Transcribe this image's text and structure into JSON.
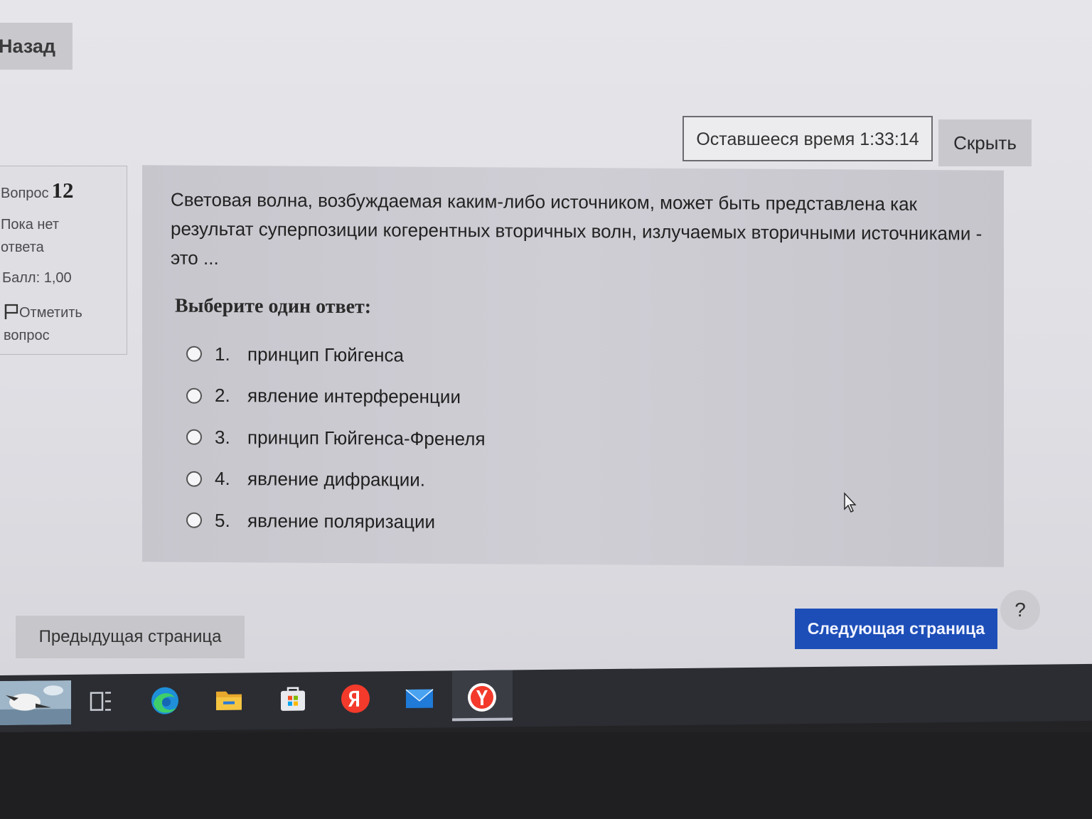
{
  "nav": {
    "back_label": "Назад"
  },
  "timer": {
    "text": "Оставшееся время 1:33:14",
    "hide_label": "Скрыть"
  },
  "info": {
    "question_label": "Вопрос",
    "question_number": "12",
    "status": "Пока нет ответа",
    "score": "Балл: 1,00",
    "flag_label": "Отметить вопрос"
  },
  "question": {
    "text": "Световая волна, возбуждаемая каким-либо источником,  может быть представлена как результат суперпозиции когерентных вторичных волн, излучаемых вторичными источниками - это ...",
    "prompt": "Выберите один ответ:",
    "answers": [
      {
        "num": "1.",
        "text": "принцип Гюйгенса"
      },
      {
        "num": "2.",
        "text": "явление интерференции"
      },
      {
        "num": "3.",
        "text": "принцип Гюйгенса-Френеля"
      },
      {
        "num": "4.",
        "text": "явление дифракции."
      },
      {
        "num": "5.",
        "text": "явление поляризации"
      }
    ]
  },
  "footer": {
    "prev_label": "Предыдущая страница",
    "next_label": "Следующая страница",
    "help_label": "?"
  },
  "taskbar": {
    "icons": [
      "desktop-thumbnail-icon",
      "task-view-icon",
      "edge-browser-icon",
      "file-explorer-icon",
      "microsoft-store-icon",
      "yandex-icon",
      "mail-icon",
      "yandex-browser-icon"
    ]
  },
  "colors": {
    "next_button": "#1d4eb8",
    "panel": "#cbcad1",
    "taskbar": "#2b2d33"
  }
}
